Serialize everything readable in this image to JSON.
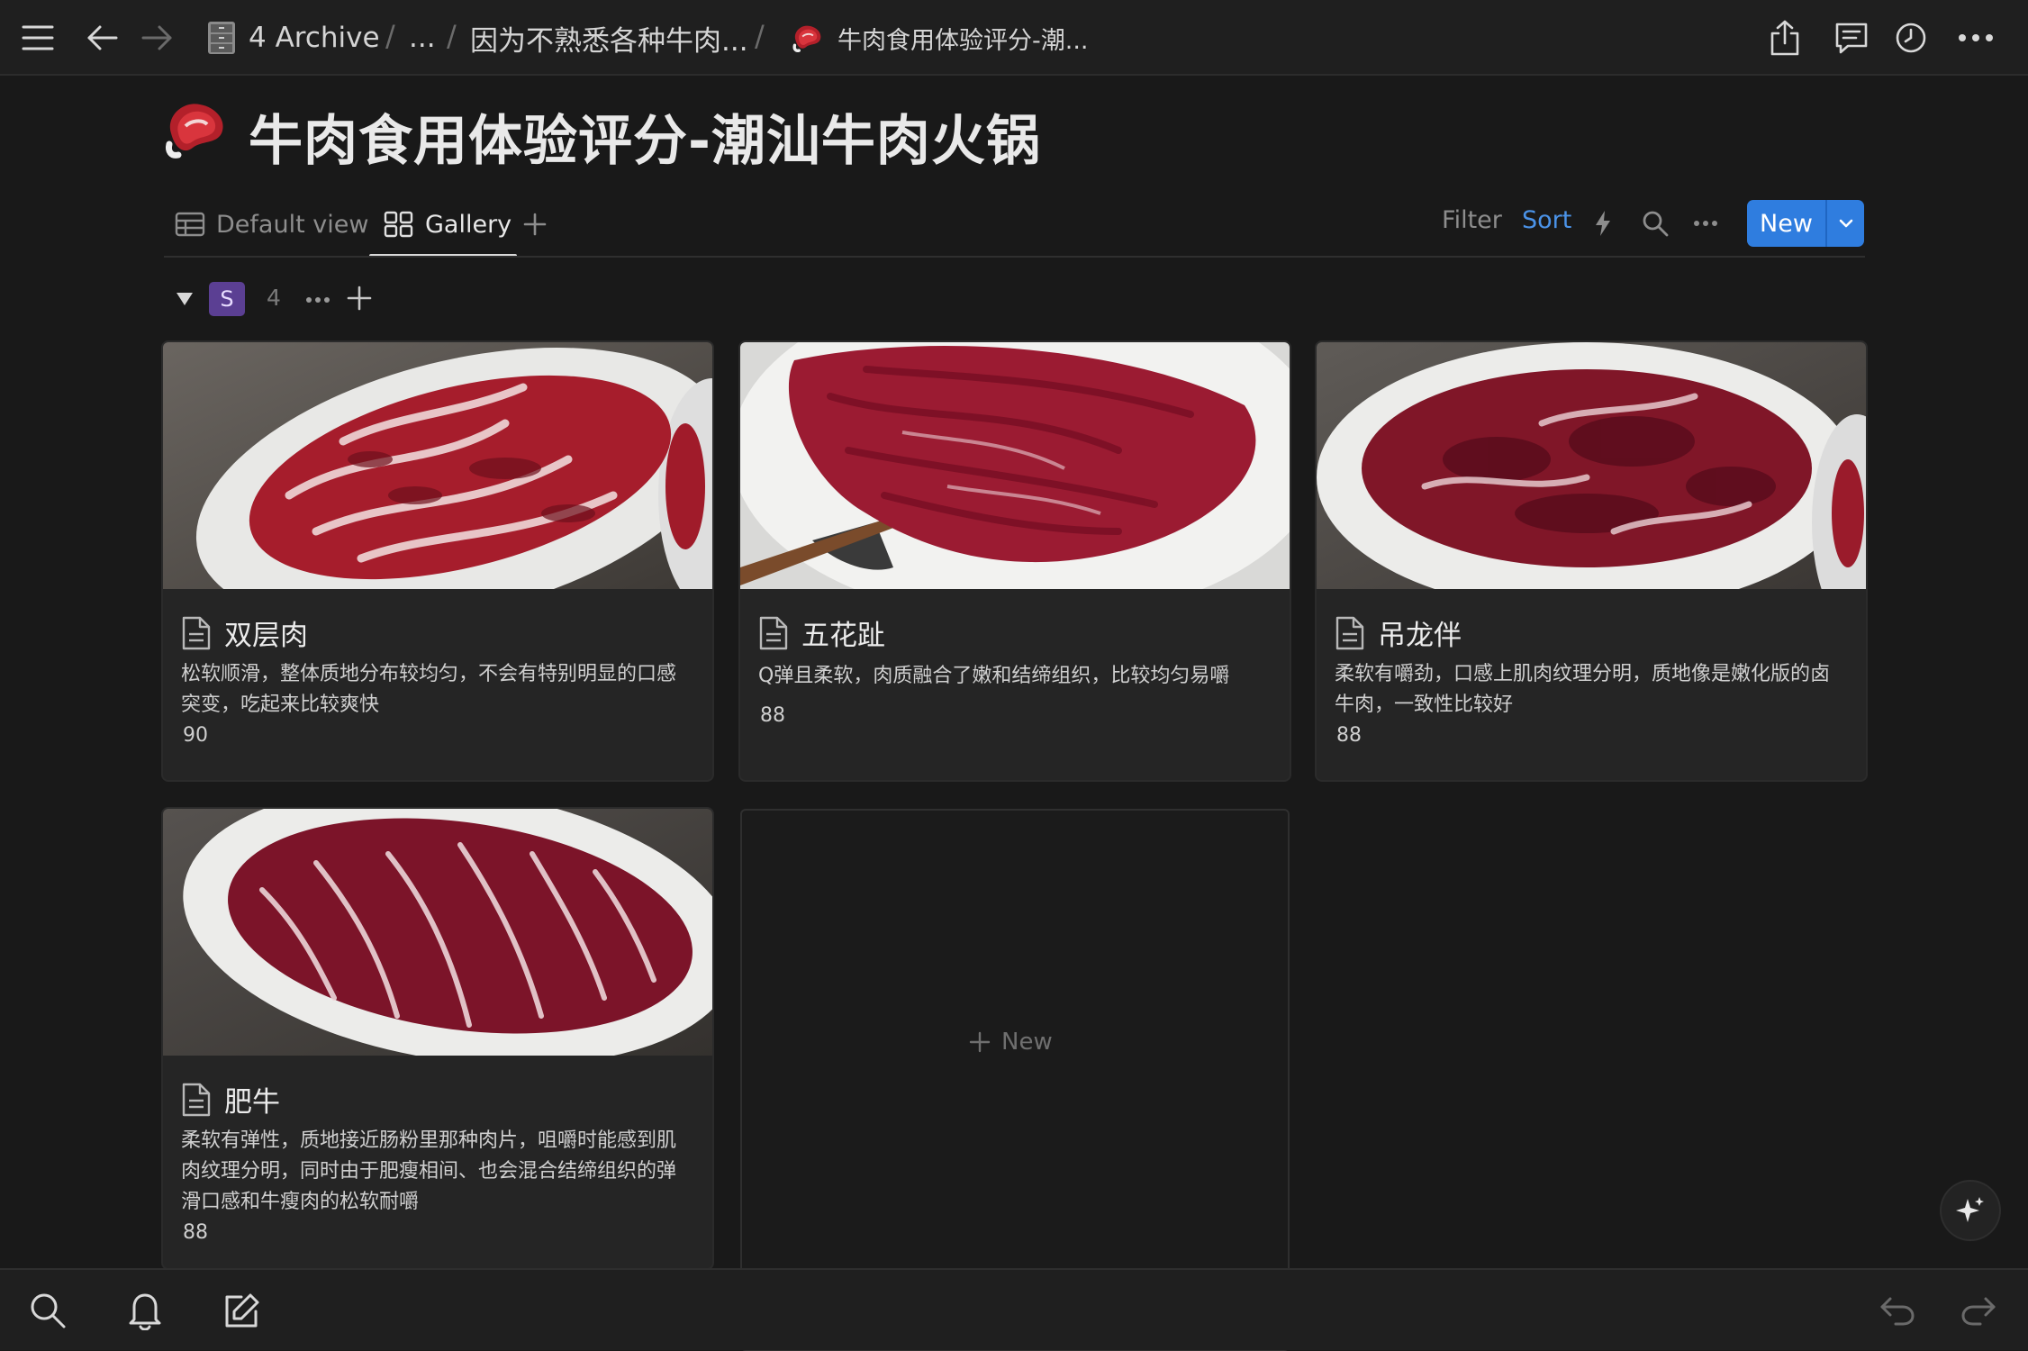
{
  "breadcrumb": {
    "archive": "4 Archive",
    "ellipsis": "...",
    "parent": "因为不熟悉各种牛肉...",
    "current": "牛肉食用体验评分-潮..."
  },
  "page": {
    "emoji": "steak-icon",
    "title": "牛肉食用体验评分-潮汕牛肉火锅"
  },
  "views": {
    "tabs": [
      {
        "label": "Default view",
        "icon": "table-icon",
        "active": false
      },
      {
        "label": "Gallery",
        "icon": "gallery-icon",
        "active": true
      }
    ]
  },
  "toolbar": {
    "filter": "Filter",
    "sort": "Sort",
    "new": "New"
  },
  "group": {
    "badge": "S",
    "count": "4"
  },
  "cards": [
    {
      "title": "双层肉",
      "description": "松软顺滑，整体质地分布较均匀，不会有特别明显的口感突变，吃起来比较爽快",
      "score": "90"
    },
    {
      "title": "五花趾",
      "description": "Q弹且柔软，肉质融合了嫩和结缔组织，比较均匀易嚼",
      "score": "88"
    },
    {
      "title": "吊龙伴",
      "description": "柔软有嚼劲，口感上肌肉纹理分明，质地像是嫩化版的卤牛肉，一致性比较好",
      "score": "88"
    },
    {
      "title": "肥牛",
      "description": "柔软有弹性，质地接近肠粉里那种肉片，咀嚼时能感到肌肉纹理分明，同时由于肥瘦相间、也会混合结缔组织的弹滑口感和牛瘦肉的松软耐嚼",
      "score": "88"
    }
  ],
  "new_card": {
    "label": "New"
  },
  "colors": {
    "accent": "#2f7ddf",
    "sort_text": "#4b93e8",
    "badge": "#5b3f93",
    "background": "#191919"
  }
}
